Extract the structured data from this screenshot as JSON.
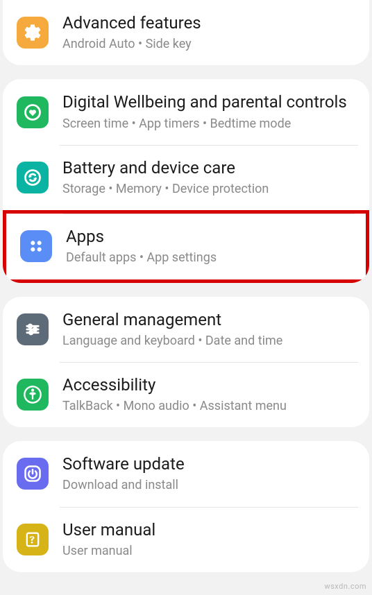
{
  "groups": [
    {
      "items": [
        {
          "id": "advanced-features",
          "icon": "cog",
          "iconBg": "#f6a93c",
          "title": "Advanced features",
          "subtitle": "Android Auto  •  Side key"
        }
      ]
    },
    {
      "items": [
        {
          "id": "digital-wellbeing",
          "icon": "heart-ring",
          "iconBg": "#1fb85e",
          "title": "Digital Wellbeing and parental controls",
          "subtitle": "Screen time  •  App timers  •  Bedtime mode"
        },
        {
          "id": "battery-device-care",
          "icon": "refresh-ring",
          "iconBg": "#0bb3a3",
          "title": "Battery and device care",
          "subtitle": "Storage  •  Memory  •  Device protection"
        },
        {
          "id": "apps",
          "icon": "four-dots",
          "iconBg": "#5a8df5",
          "title": "Apps",
          "subtitle": "Default apps  •  App settings",
          "highlighted": true
        }
      ]
    },
    {
      "items": [
        {
          "id": "general-management",
          "icon": "sliders",
          "iconBg": "#5d6a78",
          "title": "General management",
          "subtitle": "Language and keyboard  •  Date and time"
        },
        {
          "id": "accessibility",
          "icon": "person-circle",
          "iconBg": "#1fb85e",
          "title": "Accessibility",
          "subtitle": "TalkBack  •  Mono audio  •  Assistant menu"
        }
      ]
    },
    {
      "items": [
        {
          "id": "software-update",
          "icon": "power-circle",
          "iconBg": "#6a6cf0",
          "title": "Software update",
          "subtitle": "Download and install"
        },
        {
          "id": "user-manual",
          "icon": "manual",
          "iconBg": "#d6b418",
          "title": "User manual",
          "subtitle": "User manual"
        }
      ]
    }
  ],
  "watermark": "wsxdn.com"
}
